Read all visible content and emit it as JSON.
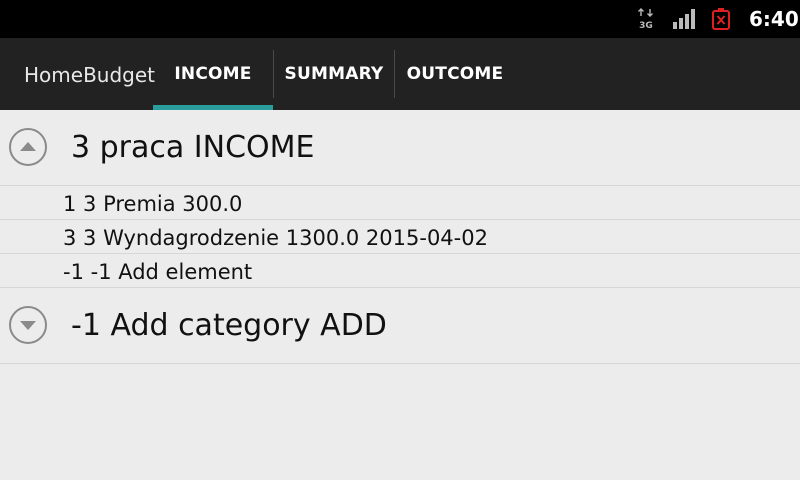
{
  "status_bar": {
    "network_icon": "3g-data-icon",
    "network_label": "3G",
    "signal_icon": "signal-strength-icon",
    "battery_icon": "battery-empty-icon",
    "time": "6:40"
  },
  "action_bar": {
    "app_title": "HomeBudget",
    "tabs": [
      {
        "label": "INCOME",
        "selected": true
      },
      {
        "label": "SUMMARY",
        "selected": false
      },
      {
        "label": "OUTCOME",
        "selected": false
      }
    ],
    "accent_color": "#2a9d9c"
  },
  "list": {
    "groups": [
      {
        "label": "3 praca INCOME",
        "expanded": true,
        "expander_icon": "collapse-up-icon",
        "children": [
          {
            "label": "1 3 Premia 300.0"
          },
          {
            "label": "3 3 Wyndagrodzenie 1300.0 2015-04-02"
          },
          {
            "label": "-1 -1 Add element"
          }
        ]
      },
      {
        "label": "-1 Add category ADD",
        "expanded": false,
        "expander_icon": "expand-down-icon",
        "children": []
      }
    ]
  }
}
